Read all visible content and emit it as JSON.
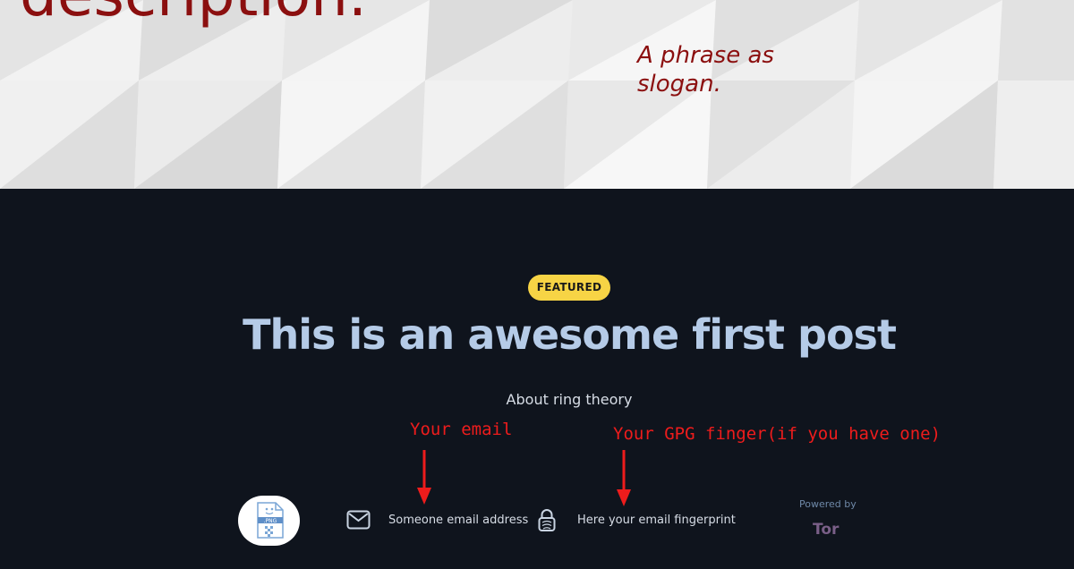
{
  "hero": {
    "title": "description.",
    "slogan": "A phrase as slogan."
  },
  "post": {
    "badge": "FEATURED",
    "title": "This is an awesome first post",
    "subtitle": "About ring theory"
  },
  "annotations": {
    "email_note": "Your email",
    "gpg_note": "Your GPG finger(if you have one)",
    "color": "#ee1c1c"
  },
  "footer": {
    "logo_label": ".PNG",
    "email": "Someone email address",
    "fingerprint": "Here your email fingerprint",
    "powered_by": "Powered by",
    "tor_label": "Tor"
  },
  "colors": {
    "hero_text": "#8b0f0f",
    "dark_bg": "#0f141d",
    "badge_bg": "#f7d445",
    "title": "#b5cbe7"
  }
}
